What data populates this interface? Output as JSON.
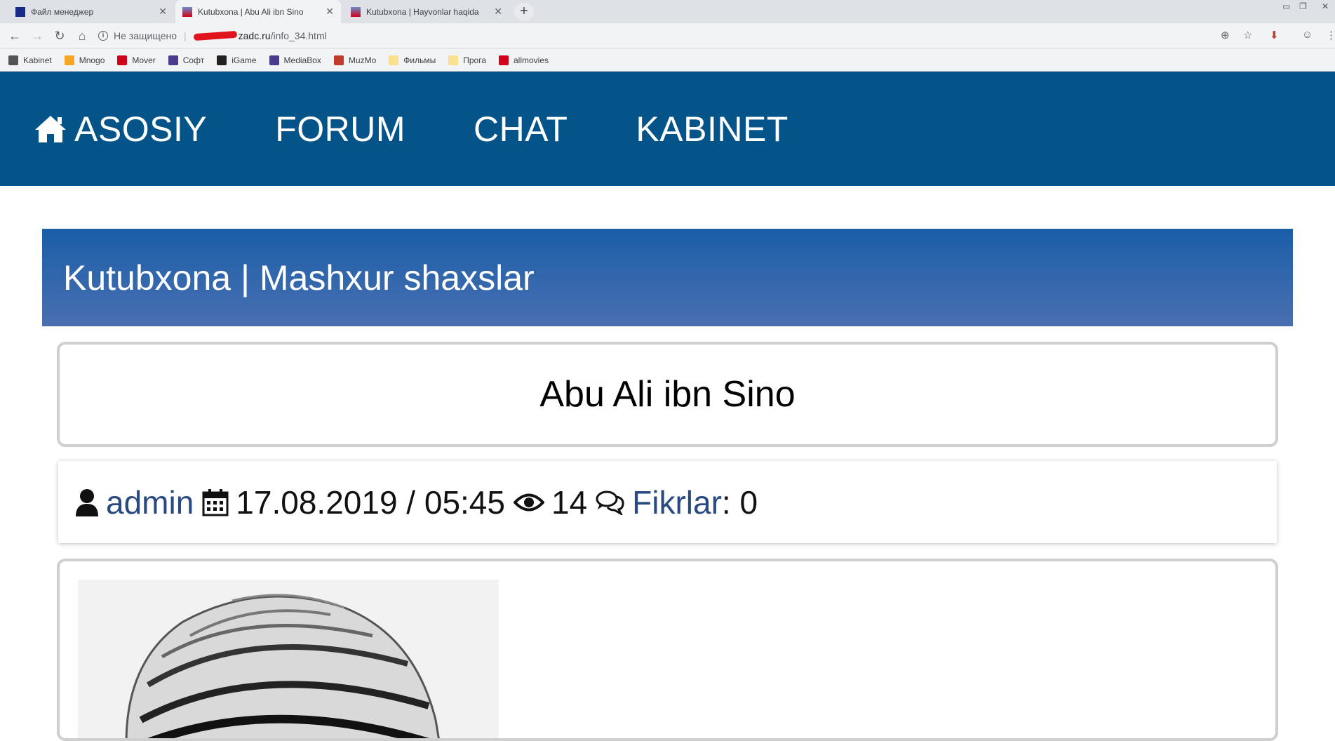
{
  "browser": {
    "tabs": [
      {
        "title": "Файл менеджер",
        "active": false
      },
      {
        "title": "Kutubxona | Abu Ali ibn Sino",
        "active": true
      },
      {
        "title": "Kutubxona | Hayvonlar haqida",
        "active": false
      }
    ],
    "new_tab_label": "+",
    "address": {
      "security_text": "Не защищено",
      "url_host": "zadc.ru",
      "url_path": "/info_34.html"
    },
    "bookmarks": [
      {
        "label": "Kabinet",
        "color": "#555555"
      },
      {
        "label": "Mnogo",
        "color": "#f5a623"
      },
      {
        "label": "Mover",
        "color": "#d0021b"
      },
      {
        "label": "Софт",
        "color": "#4a3b8c"
      },
      {
        "label": "iGame",
        "color": "#222222"
      },
      {
        "label": "MediaBox",
        "color": "#4a3b8c"
      },
      {
        "label": "MuzMo",
        "color": "#c0392b"
      },
      {
        "label": "Фильмы",
        "color": "#f8e08e"
      },
      {
        "label": "Прога",
        "color": "#f8e08e"
      },
      {
        "label": "allmovies",
        "color": "#d0021b"
      }
    ]
  },
  "site": {
    "nav": [
      {
        "label": "ASOSIY",
        "icon": "home-icon"
      },
      {
        "label": "FORUM"
      },
      {
        "label": "CHAT"
      },
      {
        "label": "KABINET"
      }
    ],
    "category_title": "Kutubxona | Mashxur shaxslar",
    "article_title": "Abu Ali ibn Sino",
    "meta": {
      "author": "admin",
      "date": "17.08.2019 / 05:45",
      "views": "14",
      "comments_label": "Fikrlar",
      "comments_count": ": 0"
    },
    "colors": {
      "nav_bg": "#045389",
      "link": "#294a80"
    }
  }
}
